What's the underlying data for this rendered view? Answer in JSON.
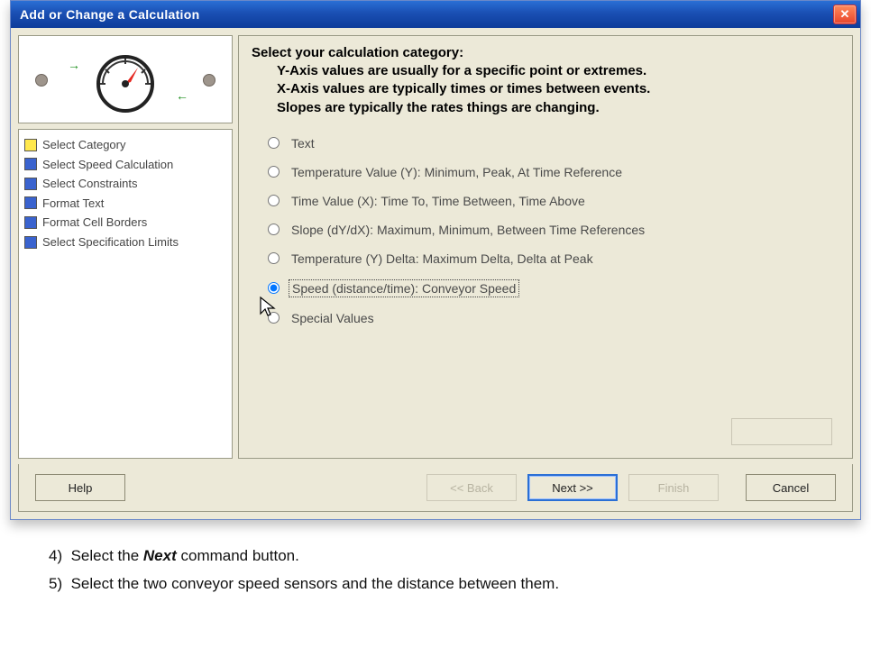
{
  "window": {
    "title": "Add or Change a Calculation"
  },
  "wizard_steps": [
    {
      "label": "Select Category",
      "state": "active"
    },
    {
      "label": "Select Speed Calculation",
      "state": "pending"
    },
    {
      "label": "Select Constraints",
      "state": "pending"
    },
    {
      "label": "Format Text",
      "state": "pending"
    },
    {
      "label": "Format Cell Borders",
      "state": "pending"
    },
    {
      "label": "Select Specification Limits",
      "state": "pending"
    }
  ],
  "main": {
    "heading": "Select your calculation category:",
    "sub1": "Y-Axis values are usually for a specific point or extremes.",
    "sub2": "X-Axis values are typically times or times between events.",
    "sub3": "Slopes are typically the rates things are changing."
  },
  "radio_options": [
    {
      "id": "text",
      "label": "Text"
    },
    {
      "id": "tempy",
      "label": "Temperature Value (Y):  Minimum, Peak, At Time Reference"
    },
    {
      "id": "timex",
      "label": "Time Value (X):  Time To, Time Between, Time Above"
    },
    {
      "id": "slope",
      "label": "Slope (dY/dX):  Maximum, Minimum, Between Time References"
    },
    {
      "id": "tdelta",
      "label": "Temperature (Y) Delta:  Maximum Delta, Delta at Peak"
    },
    {
      "id": "speed",
      "label": "Speed (distance/time): Conveyor Speed"
    },
    {
      "id": "special",
      "label": "Special Values"
    }
  ],
  "selected_radio": "speed",
  "ghost": {
    "caption": "",
    "button": ""
  },
  "footer": {
    "help": "Help",
    "back": "<< Back",
    "next": "Next >>",
    "finish": "Finish",
    "cancel": "Cancel"
  },
  "instructions": {
    "items": [
      {
        "n": "4)",
        "pre": "Select the ",
        "cmd": "Next",
        "post": " command button."
      },
      {
        "n": "5)",
        "pre": "Select the two conveyor speed sensors and the distance between them.",
        "cmd": "",
        "post": ""
      }
    ]
  }
}
